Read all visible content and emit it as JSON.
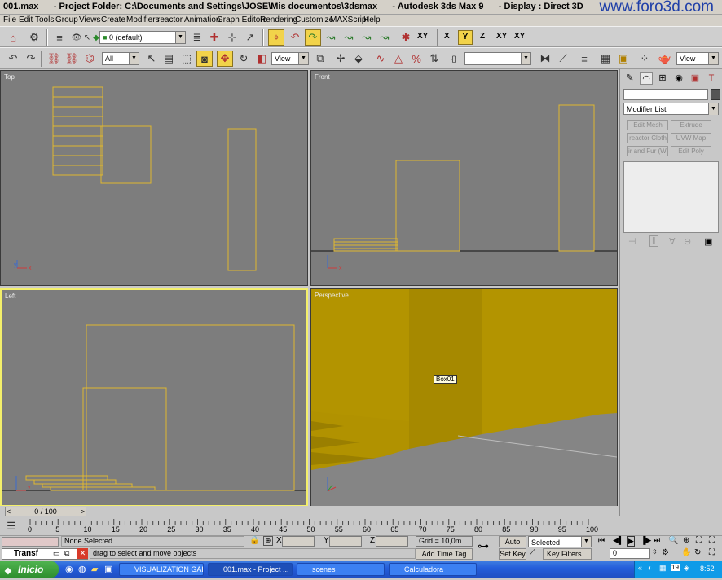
{
  "titlebar": {
    "text": "001.max      - Project Folder: C:\\Documents and Settings\\JOSE\\Mis documentos\\3dsmax      - Autodesk 3ds Max 9      - Display : Direct 3D",
    "watermark": "www.foro3d.com"
  },
  "menu": [
    "File",
    "Edit",
    "Tools",
    "Group",
    "Views",
    "Create",
    "Modifiers",
    "reactor",
    "Animation",
    "Graph Editors",
    "Rendering",
    "Customize",
    "MAXScript",
    "Help"
  ],
  "main_toolbar": {
    "layer_combo": "0 (default)",
    "axis": [
      "X",
      "Y",
      "Z",
      "XY",
      "XY"
    ]
  },
  "second_toolbar": {
    "selection_filter": "All",
    "reference_coord": "View",
    "named_selection": "",
    "render_combo": "View"
  },
  "viewports": {
    "top": "Top",
    "front": "Front",
    "left": "Left",
    "perspective": "Perspective",
    "object_label": "Box01"
  },
  "command_panel": {
    "name_field": "",
    "modifier_list": "Modifier List",
    "buttons": [
      "Edit Mesh",
      "Extrude",
      "reactor Cloth",
      "UVW Map",
      "ir and Fur (WS",
      "Edit Poly"
    ]
  },
  "timeline": {
    "frame_counter": "0 / 100",
    "ticks": [
      "0",
      "5",
      "10",
      "15",
      "20",
      "25",
      "30",
      "35",
      "40",
      "45",
      "50",
      "55",
      "60",
      "65",
      "70",
      "75",
      "80",
      "85",
      "90",
      "95",
      "100"
    ]
  },
  "status": {
    "selection": "None Selected",
    "prompt": "drag to select and move objects",
    "x_label": "X",
    "y_label": "Y",
    "z_label": "Z",
    "grid": "Grid = 10,0m",
    "add_time_tag": "Add Time Tag",
    "auto_key": "Auto Key",
    "set_key": "Set Key",
    "key_mode": "Selected",
    "key_filters": "Key Filters...",
    "frame": "0",
    "mini_listener": "Transf"
  },
  "taskbar": {
    "start": "Inicio",
    "tasks": [
      "VISUALIZATION GALL...",
      "001.max    - Project ...",
      "scenes",
      "Calculadora"
    ],
    "clock": "8:52",
    "tray_number": "19"
  },
  "colors": {
    "viewport_bg": "#7d7d7d",
    "wireframe": "#e0b830",
    "perspective_object": "#b39400",
    "active_viewport_border": "#f3ef6a",
    "taskbar": "#245edb"
  }
}
